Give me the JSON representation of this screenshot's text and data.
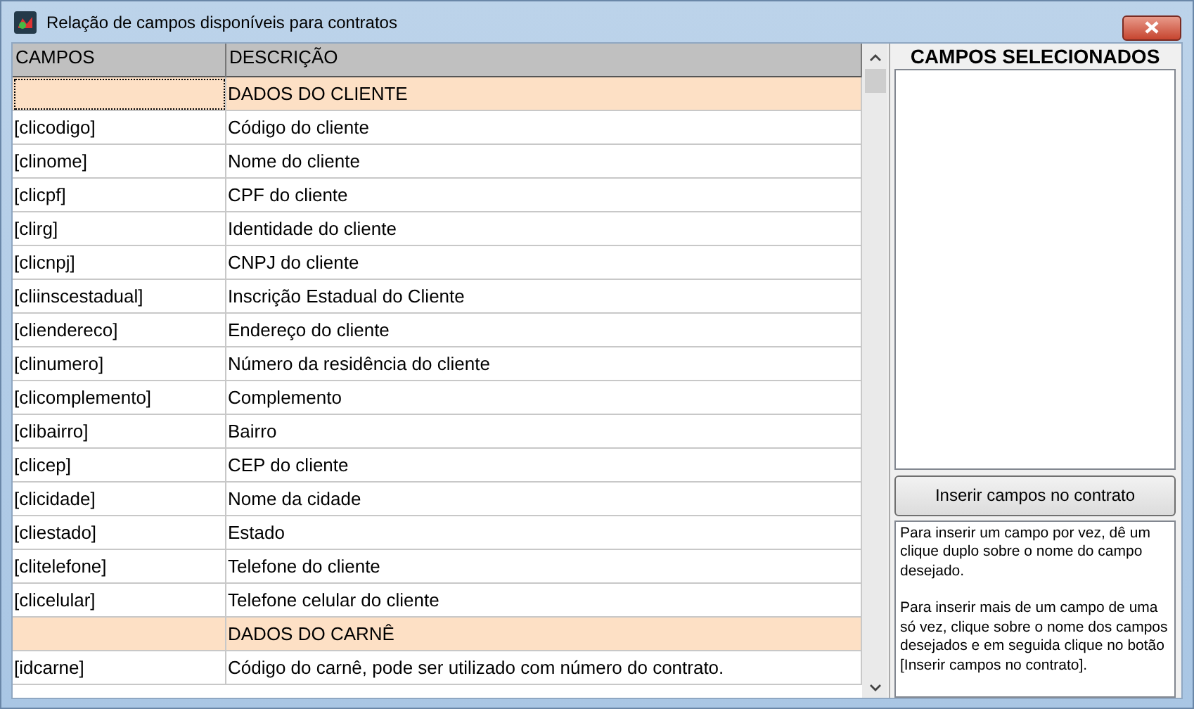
{
  "window": {
    "title": "Relação de campos disponíveis para contratos"
  },
  "table": {
    "columns": [
      "CAMPOS",
      "DESCRIÇÃO"
    ],
    "rows": [
      {
        "kind": "section",
        "field": "",
        "description": "DADOS DO CLIENTE",
        "focused": true
      },
      {
        "kind": "field",
        "field": "[clicodigo]",
        "description": "Código do cliente",
        "focused": false
      },
      {
        "kind": "field",
        "field": "[clinome]",
        "description": "Nome do cliente",
        "focused": false
      },
      {
        "kind": "field",
        "field": "[clicpf]",
        "description": "CPF do cliente",
        "focused": false
      },
      {
        "kind": "field",
        "field": "[clirg]",
        "description": "Identidade do cliente",
        "focused": false
      },
      {
        "kind": "field",
        "field": "[clicnpj]",
        "description": "CNPJ do cliente",
        "focused": false
      },
      {
        "kind": "field",
        "field": "[cliinscestadual]",
        "description": "Inscrição Estadual do Cliente",
        "focused": false
      },
      {
        "kind": "field",
        "field": "[cliendereco]",
        "description": "Endereço do cliente",
        "focused": false
      },
      {
        "kind": "field",
        "field": "[clinumero]",
        "description": "Número da residência do cliente",
        "focused": false
      },
      {
        "kind": "field",
        "field": "[clicomplemento]",
        "description": "Complemento",
        "focused": false
      },
      {
        "kind": "field",
        "field": "[clibairro]",
        "description": "Bairro",
        "focused": false
      },
      {
        "kind": "field",
        "field": "[clicep]",
        "description": "CEP do cliente",
        "focused": false
      },
      {
        "kind": "field",
        "field": "[clicidade]",
        "description": "Nome da cidade",
        "focused": false
      },
      {
        "kind": "field",
        "field": "[cliestado]",
        "description": "Estado",
        "focused": false
      },
      {
        "kind": "field",
        "field": "[clitelefone]",
        "description": "Telefone do cliente",
        "focused": false
      },
      {
        "kind": "field",
        "field": "[clicelular]",
        "description": "Telefone celular do cliente",
        "focused": false
      },
      {
        "kind": "section",
        "field": "",
        "description": "DADOS DO CARNÊ",
        "focused": false
      },
      {
        "kind": "field",
        "field": "[idcarne]",
        "description": "Código do carnê, pode ser utilizado com número do contrato.",
        "focused": false
      }
    ]
  },
  "selected_panel": {
    "title": "CAMPOS SELECIONADOS"
  },
  "insert_button": "Inserir campos no contrato",
  "help": [
    "Para inserir um campo por vez, dê um clique duplo sobre o nome do campo desejado.",
    "Para inserir mais de um campo de uma só vez, clique sobre o nome dos campos desejados e em seguida clique no botão [Inserir campos no contrato]."
  ]
}
